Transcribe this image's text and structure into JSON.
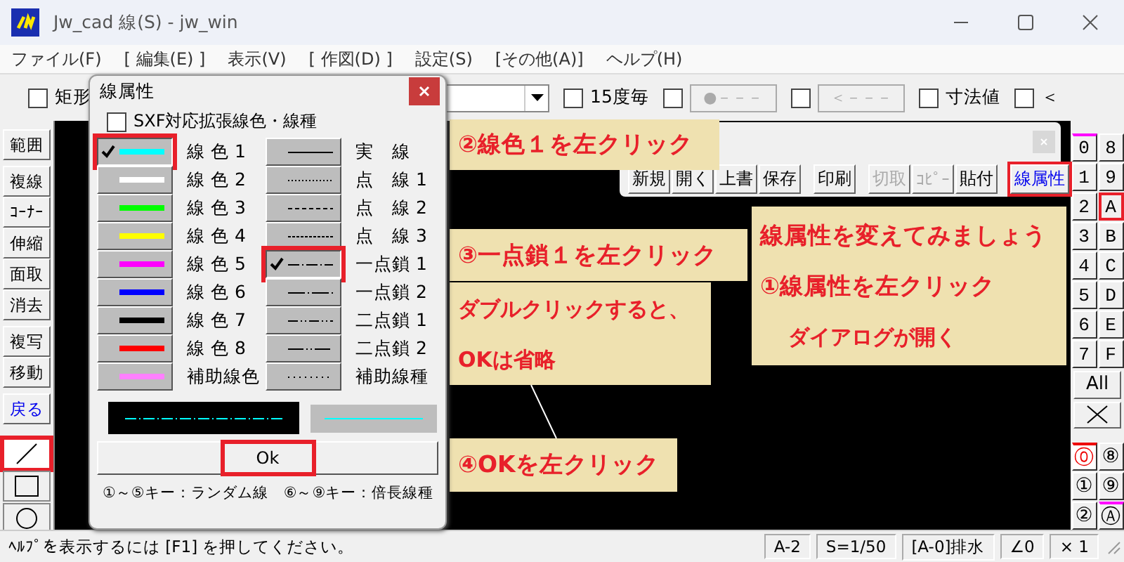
{
  "window": {
    "title": "Jw_cad 線(S) - jw_win"
  },
  "menu": [
    "ファイル(F)",
    "[ 編集(E) ]",
    "表示(V)",
    "[ 作図(D) ]",
    "設定(S)",
    "[その他(A)]",
    "ヘルプ(H)"
  ],
  "toolbar": [
    {
      "kind": "checkbox",
      "label": "矩形",
      "checked": false
    },
    {
      "kind": "dropdown"
    },
    {
      "kind": "checkbox",
      "label": "15度毎",
      "checked": false
    },
    {
      "kind": "checkbox-button",
      "label": "●－－－",
      "checked": false
    },
    {
      "kind": "checkbox-button",
      "label": "＜－－－",
      "checked": false
    },
    {
      "kind": "checkbox",
      "label": "寸法値",
      "checked": false
    },
    {
      "kind": "checkbox",
      "label": "＜",
      "checked": false
    }
  ],
  "left_toolbar": {
    "command_groups": [
      [
        {
          "label": "範囲",
          "kind": "command"
        }
      ],
      [
        {
          "label": "複線",
          "kind": "command"
        },
        {
          "label": "ｺｰﾅｰ",
          "kind": "command"
        },
        {
          "label": "伸縮",
          "kind": "command"
        },
        {
          "label": "面取",
          "kind": "command"
        },
        {
          "label": "消去",
          "kind": "command"
        }
      ],
      [
        {
          "label": "複写",
          "kind": "command"
        },
        {
          "label": "移動",
          "kind": "command"
        }
      ],
      [
        {
          "label": "戻る",
          "kind": "undo"
        }
      ]
    ],
    "tools": [
      {
        "kind": "line",
        "selected": true,
        "highlighted": true
      },
      {
        "kind": "rect",
        "selected": false,
        "highlighted": false
      },
      {
        "kind": "circle",
        "selected": false,
        "highlighted": false
      }
    ]
  },
  "file_toolbar": {
    "groups": [
      [
        {
          "label": "新規",
          "disabled": false,
          "highlighted": false
        },
        {
          "label": "開く",
          "disabled": false,
          "highlighted": false
        },
        {
          "label": "上書",
          "disabled": false,
          "highlighted": false
        },
        {
          "label": "保存",
          "disabled": false,
          "highlighted": false
        }
      ],
      [
        {
          "label": "印刷",
          "disabled": false,
          "highlighted": false
        }
      ],
      [
        {
          "label": "切取",
          "disabled": true,
          "highlighted": false
        },
        {
          "label": "ｺﾋﾟｰ",
          "disabled": true,
          "highlighted": false
        },
        {
          "label": "貼付",
          "disabled": false,
          "highlighted": false
        }
      ],
      [
        {
          "label": "線属性",
          "disabled": false,
          "highlighted": true
        }
      ]
    ]
  },
  "dialog": {
    "title": "線属性",
    "sxf": {
      "label": "SXF対応拡張線色・線種",
      "checked": false
    },
    "colors": [
      {
        "label": "線 色 1",
        "color": "#00ffff",
        "selected": true,
        "highlighted": true
      },
      {
        "label": "線 色 2",
        "color": "#ffffff",
        "selected": false,
        "highlighted": false
      },
      {
        "label": "線 色 3",
        "color": "#00ff00",
        "selected": false,
        "highlighted": false
      },
      {
        "label": "線 色 4",
        "color": "#ffff00",
        "selected": false,
        "highlighted": false
      },
      {
        "label": "線 色 5",
        "color": "#ff00ff",
        "selected": false,
        "highlighted": false
      },
      {
        "label": "線 色 6",
        "color": "#0000ff",
        "selected": false,
        "highlighted": false
      },
      {
        "label": "線 色 7",
        "color": "#000000",
        "selected": false,
        "highlighted": false
      },
      {
        "label": "線 色 8",
        "color": "#ff0000",
        "selected": false,
        "highlighted": false
      },
      {
        "label": "補助線色",
        "color": "#ff80ff",
        "selected": false,
        "highlighted": false
      }
    ],
    "line_types": [
      {
        "label": "実　線",
        "kind": "solid",
        "selected": false,
        "highlighted": false
      },
      {
        "label": "点　線 1",
        "kind": "dot",
        "selected": false,
        "highlighted": false
      },
      {
        "label": "点　線 2",
        "kind": "dash",
        "selected": false,
        "highlighted": false
      },
      {
        "label": "点　線 3",
        "kind": "short-dash",
        "selected": false,
        "highlighted": false
      },
      {
        "label": "一点鎖 1",
        "kind": "chain",
        "selected": true,
        "highlighted": true
      },
      {
        "label": "一点鎖 2",
        "kind": "long-chain",
        "selected": false,
        "highlighted": false
      },
      {
        "label": "二点鎖 1",
        "kind": "double-chain",
        "selected": false,
        "highlighted": false
      },
      {
        "label": "二点鎖 2",
        "kind": "long-double-chain",
        "selected": false,
        "highlighted": false
      },
      {
        "label": "補助線種",
        "kind": "aux",
        "selected": false,
        "highlighted": false
      }
    ],
    "ok": {
      "label": "Ok",
      "highlighted": true
    },
    "footer": "①～⑤キー：ランダム線　⑥～⑨キー：倍長線種"
  },
  "callouts": [
    {
      "kind": "step2",
      "lines": [
        "②線色１を左クリック"
      ]
    },
    {
      "kind": "step3",
      "lines": [
        "③一点鎖１を左クリック"
      ]
    },
    {
      "kind": "note",
      "lines": [
        "ダブルクリックすると、",
        "OKは省略"
      ]
    },
    {
      "kind": "intro",
      "lines": [
        "線属性を変えてみましょう",
        "①線属性を左クリック",
        "ダイアログが開く"
      ]
    },
    {
      "kind": "step4",
      "lines": [
        "④OKを左クリック"
      ]
    }
  ],
  "layers": [
    [
      {
        "label": "0",
        "selected": false,
        "marked": true
      },
      {
        "label": "8",
        "selected": false,
        "marked": false
      }
    ],
    [
      {
        "label": "1",
        "selected": false,
        "marked": false
      },
      {
        "label": "9",
        "selected": false,
        "marked": false
      }
    ],
    [
      {
        "label": "2",
        "selected": false,
        "marked": false
      },
      {
        "label": "A",
        "selected": true,
        "marked": false
      }
    ],
    [
      {
        "label": "3",
        "selected": false,
        "marked": false
      },
      {
        "label": "B",
        "selected": false,
        "marked": false
      }
    ],
    [
      {
        "label": "4",
        "selected": false,
        "marked": false
      },
      {
        "label": "C",
        "selected": false,
        "marked": false
      }
    ],
    [
      {
        "label": "5",
        "selected": false,
        "marked": false
      },
      {
        "label": "D",
        "selected": false,
        "marked": false
      }
    ],
    [
      {
        "label": "6",
        "selected": false,
        "marked": false
      },
      {
        "label": "E",
        "selected": false,
        "marked": false
      }
    ],
    [
      {
        "label": "7",
        "selected": false,
        "marked": false
      },
      {
        "label": "F",
        "selected": false,
        "marked": false
      }
    ]
  ],
  "all_button": "All",
  "groups": [
    [
      {
        "label": "⓪",
        "selected": true,
        "marked": false
      },
      {
        "label": "⑧",
        "selected": false,
        "marked": false
      }
    ],
    [
      {
        "label": "①",
        "selected": false,
        "marked": false
      },
      {
        "label": "⑨",
        "selected": false,
        "marked": false
      }
    ],
    [
      {
        "label": "②",
        "selected": false,
        "marked": false
      },
      {
        "label": "Ⓐ",
        "selected": false,
        "marked": true
      }
    ]
  ],
  "status_bar": {
    "help": "ﾍﾙﾌﾟを表示するには [F1] を押してください。",
    "fields": [
      "A-2",
      "S=1/50",
      "[A-0]排水",
      "∠0",
      "× 1"
    ]
  }
}
